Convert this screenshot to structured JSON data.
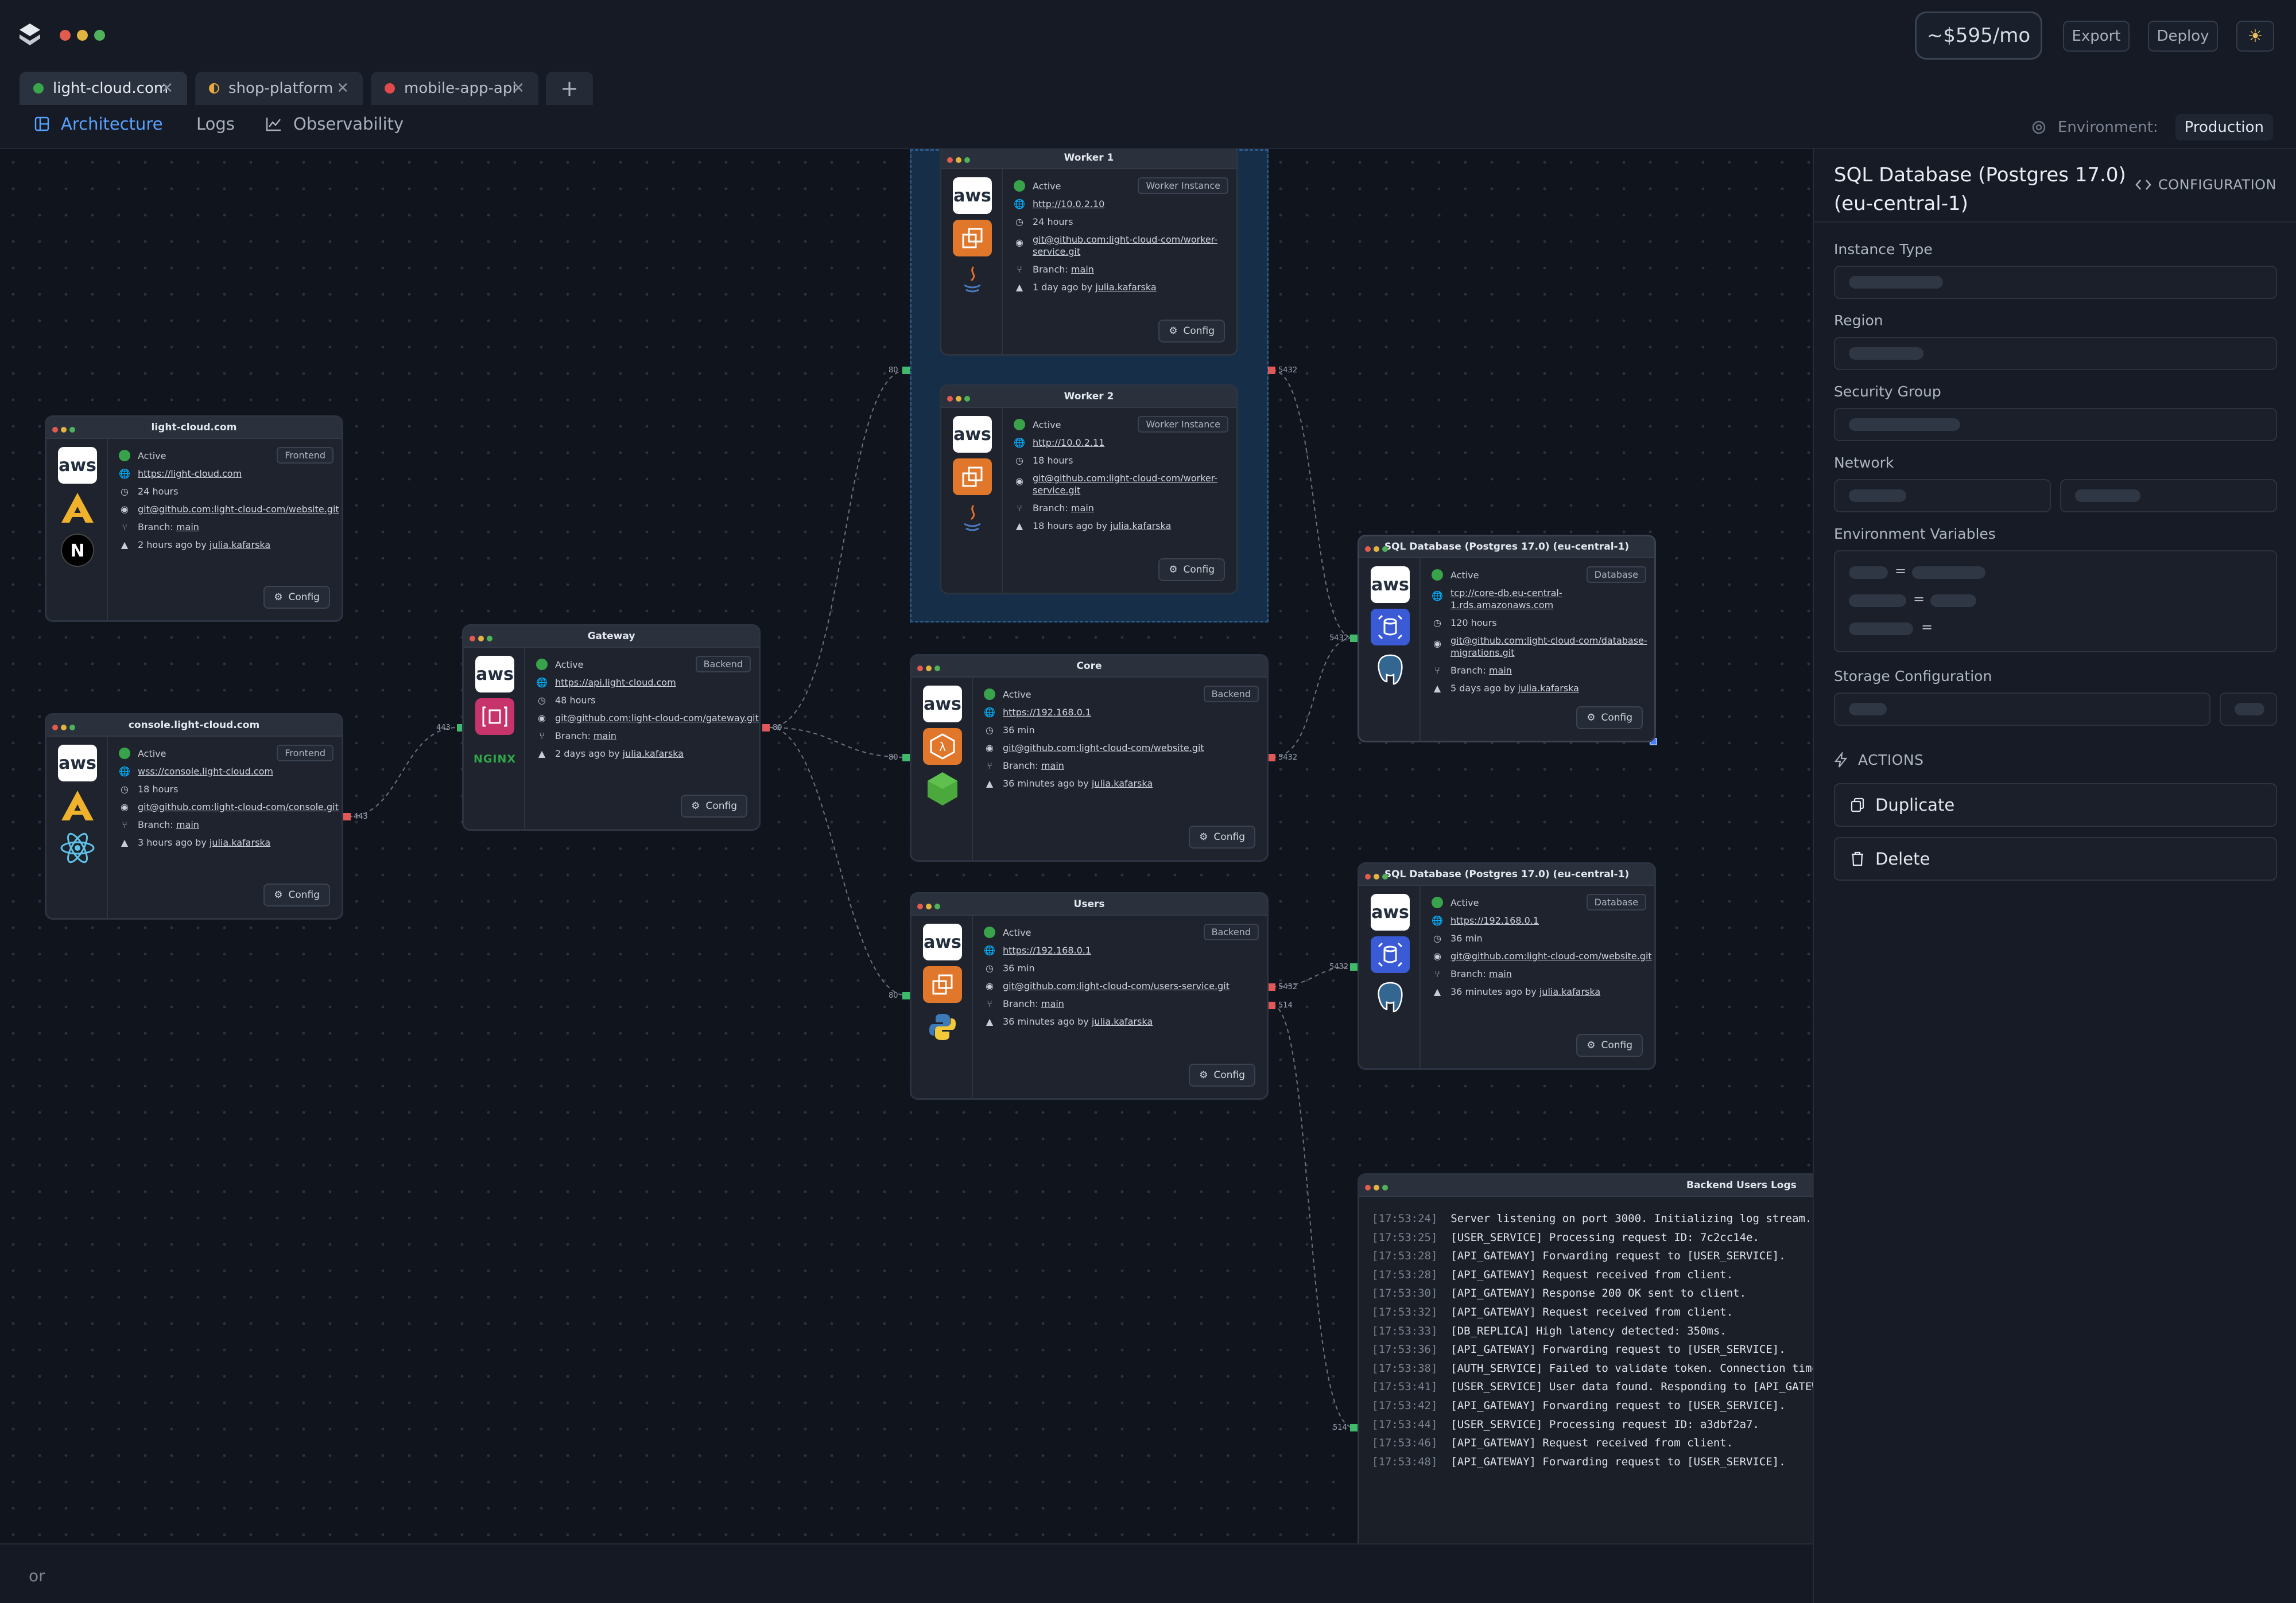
{
  "header": {
    "cost": "~$595/mo",
    "export_label": "Export",
    "deploy_label": "Deploy"
  },
  "tabs": [
    {
      "label": "light-cloud.com",
      "color": "#3aa64c"
    },
    {
      "label": "shop-platform",
      "color": "#e7a93a"
    },
    {
      "label": "mobile-app-api",
      "color": "#e04a4a"
    }
  ],
  "nav": {
    "architecture": "Architecture",
    "logs": "Logs",
    "observability": "Observability",
    "environment_label": "Environment:",
    "environment_value": "Production"
  },
  "nodes": {
    "light_cloud": {
      "title": "light-cloud.com",
      "badge": "Frontend",
      "status": "Active",
      "url": "https://light-cloud.com",
      "uptime": "24 hours",
      "repo": "git@github.com:light-cloud-com/website.git",
      "branch_label": "Branch:",
      "branch": "main",
      "deployed": "2 hours ago by",
      "user": "julia.kafarska",
      "config": "Config",
      "icons": [
        "aws-icon",
        "angular-icon",
        "nextjs-icon"
      ]
    },
    "console": {
      "title": "console.light-cloud.com",
      "badge": "Frontend",
      "status": "Active",
      "url": "wss://console.light-cloud.com",
      "uptime": "18 hours",
      "repo": "git@github.com:light-cloud-com/console.git",
      "branch_label": "Branch:",
      "branch": "main",
      "deployed": "3 hours ago by",
      "user": "julia.kafarska",
      "config": "Config",
      "icons": [
        "aws-icon",
        "angular-icon",
        "react-icon"
      ]
    },
    "gateway": {
      "title": "Gateway",
      "badge": "Backend",
      "status": "Active",
      "url": "https://api.light-cloud.com",
      "uptime": "48 hours",
      "repo": "git@github.com:light-cloud-com/gateway.git",
      "branch_label": "Branch:",
      "branch": "main",
      "deployed": "2 days ago by",
      "user": "julia.kafarska",
      "config": "Config",
      "nginx": "NGINX",
      "icons": [
        "aws-icon",
        "api-gateway-icon",
        "nginx-icon"
      ]
    },
    "worker1": {
      "title": "Worker 1",
      "badge": "Worker Instance",
      "status": "Active",
      "url": "http://10.0.2.10",
      "uptime": "24 hours",
      "repo_line1": "git@github.com:light-cloud-com/worker-",
      "repo_line2": "service.git",
      "branch_label": "Branch:",
      "branch": "main",
      "deployed": "1 day ago by",
      "user": "julia.kafarska",
      "config": "Config",
      "icons": [
        "aws-icon",
        "ec2-icon",
        "java-icon"
      ]
    },
    "worker2": {
      "title": "Worker 2",
      "badge": "Worker Instance",
      "status": "Active",
      "url": "http://10.0.2.11",
      "uptime": "18 hours",
      "repo_line1": "git@github.com:light-cloud-com/worker-",
      "repo_line2": "service.git",
      "branch_label": "Branch:",
      "branch": "main",
      "deployed": "18 hours ago by",
      "user": "julia.kafarska",
      "config": "Config",
      "icons": [
        "aws-icon",
        "ec2-icon",
        "java-icon"
      ]
    },
    "core": {
      "title": "Core",
      "badge": "Backend",
      "status": "Active",
      "url": "https://192.168.0.1",
      "uptime": "36 min",
      "repo": "git@github.com:light-cloud-com/website.git",
      "branch_label": "Branch:",
      "branch": "main",
      "deployed": "36 minutes ago by",
      "user": "julia.kafarska",
      "config": "Config",
      "icons": [
        "aws-icon",
        "lambda-icon",
        "nodejs-icon"
      ]
    },
    "users": {
      "title": "Users",
      "badge": "Backend",
      "status": "Active",
      "url": "https://192.168.0.1",
      "uptime": "36 min",
      "repo": "git@github.com:light-cloud-com/users-service.git",
      "branch_label": "Branch:",
      "branch": "main",
      "deployed": "36 minutes ago by",
      "user": "julia.kafarska",
      "config": "Config",
      "icons": [
        "aws-icon",
        "ec2-icon",
        "python-icon"
      ]
    },
    "db1": {
      "title": "SQL Database (Postgres 17.0) (eu-central-1)",
      "badge": "Database",
      "status": "Active",
      "url_line1": "tcp://core-db.eu-central-",
      "url_line2": "1.rds.amazonaws.com",
      "uptime": "120 hours",
      "repo_line1": "git@github.com:light-cloud-com/database-",
      "repo_line2": "migrations.git",
      "branch_label": "Branch:",
      "branch": "main",
      "deployed": "5 days ago by",
      "user": "julia.kafarska",
      "config": "Config",
      "icons": [
        "aws-icon",
        "rds-icon",
        "postgres-icon"
      ]
    },
    "db2": {
      "title": "SQL Database (Postgres 17.0) (eu-central-1)",
      "badge": "Database",
      "status": "Active",
      "url": "https://192.168.0.1",
      "uptime": "36 min",
      "repo": "git@github.com:light-cloud-com/website.git",
      "branch_label": "Branch:",
      "branch": "main",
      "deployed": "36 minutes ago by",
      "user": "julia.kafarska",
      "config": "Config",
      "icons": [
        "aws-icon",
        "rds-icon",
        "postgres-icon"
      ]
    }
  },
  "ports": {
    "p443a": "443",
    "p443b": "443",
    "p80a": "80",
    "p80b": "80",
    "p80c": "80",
    "p80d": "80",
    "p5432a": "5432",
    "p5432b": "5432",
    "p5432c": "5432",
    "p5432d": "5432",
    "p5432e": "5432",
    "p514a": "514",
    "p514b": "514"
  },
  "logs": {
    "title": "Backend Users Logs",
    "lines": [
      {
        "ts": "[17:53:24]",
        "msg": "Server listening on port 3000. Initializing log stream..."
      },
      {
        "ts": "[17:53:25]",
        "msg": "[USER_SERVICE] Processing request ID: 7c2cc14e."
      },
      {
        "ts": "[17:53:28]",
        "msg": "[API_GATEWAY] Forwarding request to [USER_SERVICE]."
      },
      {
        "ts": "[17:53:28]",
        "msg": "[API_GATEWAY] Request received from client."
      },
      {
        "ts": "[17:53:30]",
        "msg": "[API_GATEWAY] Response 200 OK sent to client."
      },
      {
        "ts": "[17:53:32]",
        "msg": "[API_GATEWAY] Request received from client."
      },
      {
        "ts": "[17:53:33]",
        "msg": "[DB_REPLICA] High latency detected: 350ms."
      },
      {
        "ts": "[17:53:36]",
        "msg": "[API_GATEWAY] Forwarding request to [USER_SERVICE]."
      },
      {
        "ts": "[17:53:38]",
        "msg": "[AUTH_SERVICE] Failed to validate token. Connection timed o"
      },
      {
        "ts": "[17:53:41]",
        "msg": "[USER_SERVICE] User data found. Responding to [API_GATEWAY]"
      },
      {
        "ts": "[17:53:42]",
        "msg": "[API_GATEWAY] Forwarding request to [USER_SERVICE]."
      },
      {
        "ts": "[17:53:44]",
        "msg": "[USER_SERVICE] Processing request ID: a3dbf2a7."
      },
      {
        "ts": "[17:53:46]",
        "msg": "[API_GATEWAY] Request received from client."
      },
      {
        "ts": "[17:53:48]",
        "msg": "[API_GATEWAY] Forwarding request to [USER_SERVICE]."
      }
    ]
  },
  "chat": {
    "placeholder": "or"
  },
  "panel": {
    "title": "SQL Database (Postgres 17.0) (eu-central-1)",
    "configuration": "CONFIGURATION",
    "instance_type": "Instance Type",
    "region": "Region",
    "security_group": "Security Group",
    "network": "Network",
    "env_vars": "Environment Variables",
    "storage": "Storage Configuration",
    "actions": "ACTIONS",
    "duplicate": "Duplicate",
    "delete": "Delete",
    "eq": "="
  },
  "colors": {
    "accent": "#5aa2ff",
    "active": "#38a34a",
    "port_in": "#3fb96a",
    "port_out": "#e05858"
  }
}
